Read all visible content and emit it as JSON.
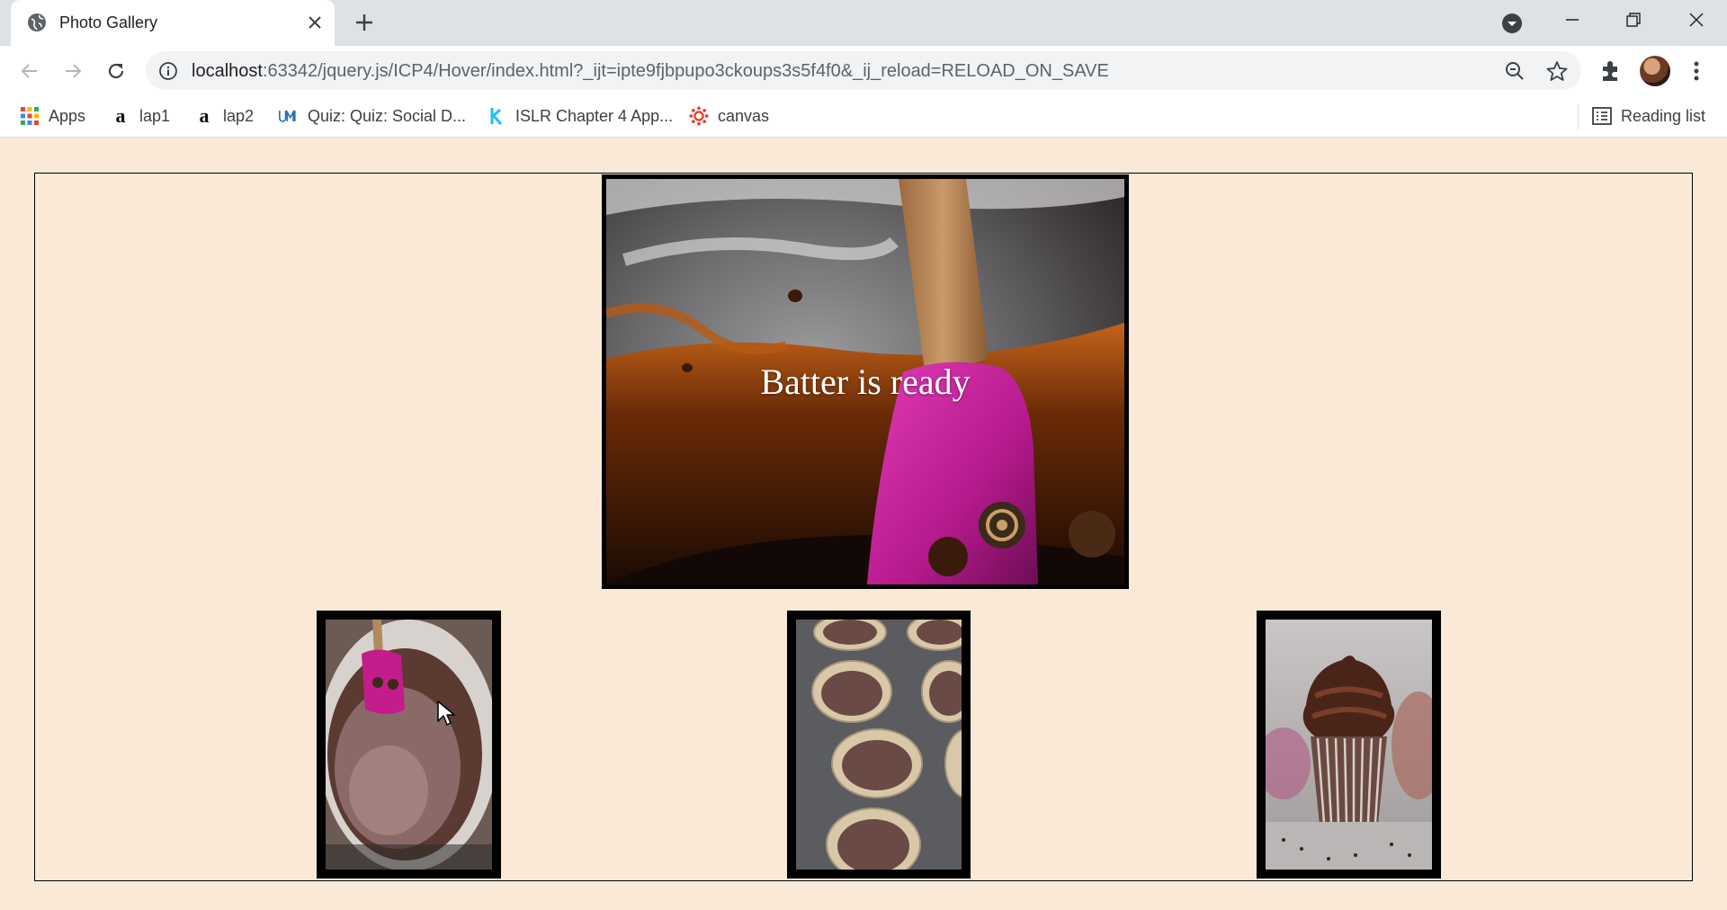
{
  "browser": {
    "tab_title": "Photo Gallery",
    "url_host": "localhost",
    "url_rest": ":63342/jquery.js/ICP4/Hover/index.html?_ijt=ipte9fjbpupo3ckoups3s5f4f0&_ij_reload=RELOAD_ON_SAVE",
    "bookmarks": [
      {
        "label": "Apps",
        "icon": "apps-grid-icon"
      },
      {
        "label": "lap1",
        "icon": "amazon-icon"
      },
      {
        "label": "lap2",
        "icon": "amazon-icon"
      },
      {
        "label": "Quiz: Quiz: Social D...",
        "icon": "umkc-icon"
      },
      {
        "label": "ISLR Chapter 4 App...",
        "icon": "kaggle-icon"
      },
      {
        "label": "canvas",
        "icon": "canvas-icon"
      }
    ],
    "reading_list": "Reading list"
  },
  "gallery": {
    "main_caption": "Batter is ready",
    "thumbnails": [
      {
        "name": "thumb-batter-bowl",
        "icon": "batter-bowl-photo"
      },
      {
        "name": "thumb-cupcake-tin",
        "icon": "cupcake-tin-photo"
      },
      {
        "name": "thumb-frosted-cupcake",
        "icon": "frosted-cupcake-photo"
      }
    ]
  }
}
